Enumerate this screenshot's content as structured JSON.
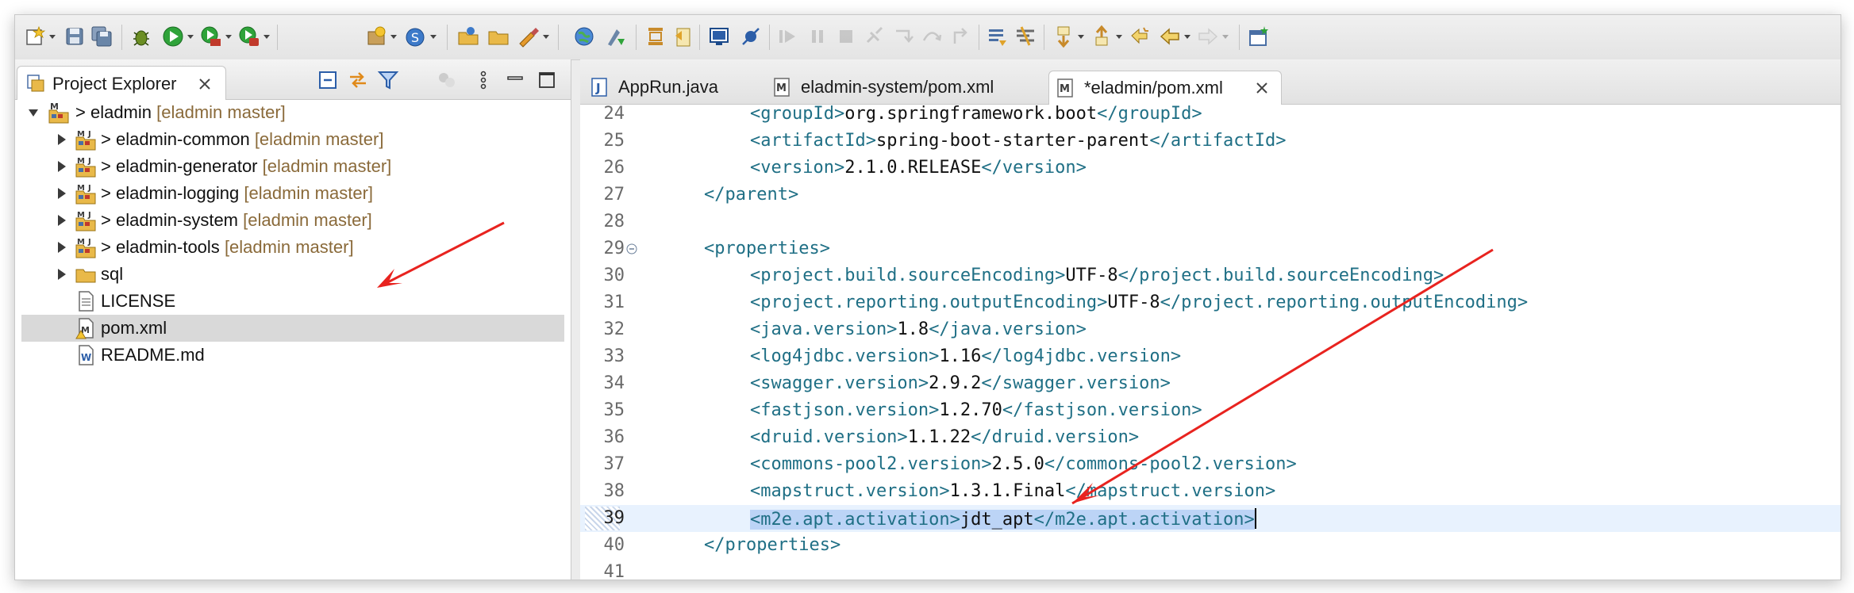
{
  "explorer": {
    "tab_label": "Project Explorer",
    "tree": [
      {
        "name": "> eladmin",
        "decoration": "[eladmin master]",
        "expanded": true,
        "level": 0
      },
      {
        "name": "> eladmin-common",
        "decoration": "[eladmin master]",
        "level": 1
      },
      {
        "name": "> eladmin-generator",
        "decoration": "[eladmin master]",
        "level": 1
      },
      {
        "name": "> eladmin-logging",
        "decoration": "[eladmin master]",
        "level": 1
      },
      {
        "name": "> eladmin-system",
        "decoration": "[eladmin master]",
        "level": 1
      },
      {
        "name": "> eladmin-tools",
        "decoration": "[eladmin master]",
        "level": 1
      },
      {
        "name": "sql",
        "decoration": "",
        "level": 1
      },
      {
        "name": "LICENSE",
        "decoration": "",
        "level": 1
      },
      {
        "name": "pom.xml",
        "decoration": "",
        "level": 1,
        "selected": true
      },
      {
        "name": "README.md",
        "decoration": "",
        "level": 1
      }
    ]
  },
  "editor": {
    "tabs": [
      {
        "label": "AppRun.java",
        "active": false
      },
      {
        "label": "eladmin-system/pom.xml",
        "active": false
      },
      {
        "label": "*eladmin/pom.xml",
        "active": true
      }
    ],
    "lines": [
      {
        "num": "24",
        "indent": 2,
        "tag1": "<groupId>",
        "value": "org.springframework.boot",
        "tag2": "</groupId>"
      },
      {
        "num": "25",
        "indent": 2,
        "tag1": "<artifactId>",
        "value": "spring-boot-starter-parent",
        "tag2": "</artifactId>"
      },
      {
        "num": "26",
        "indent": 2,
        "tag1": "<version>",
        "value": "2.1.0.RELEASE",
        "tag2": "</version>"
      },
      {
        "num": "27",
        "indent": 1,
        "tag1": "</parent>",
        "value": "",
        "tag2": ""
      },
      {
        "num": "28",
        "indent": 0,
        "tag1": "",
        "value": "",
        "tag2": ""
      },
      {
        "num": "29",
        "indent": 1,
        "tag1": "<properties>",
        "value": "",
        "tag2": "",
        "fold": true
      },
      {
        "num": "30",
        "indent": 2,
        "tag1": "<project.build.sourceEncoding>",
        "value": "UTF-8",
        "tag2": "</project.build.sourceEncoding>"
      },
      {
        "num": "31",
        "indent": 2,
        "tag1": "<project.reporting.outputEncoding>",
        "value": "UTF-8",
        "tag2": "</project.reporting.outputEncoding>"
      },
      {
        "num": "32",
        "indent": 2,
        "tag1": "<java.version>",
        "value": "1.8",
        "tag2": "</java.version>"
      },
      {
        "num": "33",
        "indent": 2,
        "tag1": "<log4jdbc.version>",
        "value": "1.16",
        "tag2": "</log4jdbc.version>"
      },
      {
        "num": "34",
        "indent": 2,
        "tag1": "<swagger.version>",
        "value": "2.9.2",
        "tag2": "</swagger.version>"
      },
      {
        "num": "35",
        "indent": 2,
        "tag1": "<fastjson.version>",
        "value": "1.2.70",
        "tag2": "</fastjson.version>"
      },
      {
        "num": "36",
        "indent": 2,
        "tag1": "<druid.version>",
        "value": "1.1.22",
        "tag2": "</druid.version>"
      },
      {
        "num": "37",
        "indent": 2,
        "tag1": "<commons-pool2.version>",
        "value": "2.5.0",
        "tag2": "</commons-pool2.version>"
      },
      {
        "num": "38",
        "indent": 2,
        "tag1": "<mapstruct.version>",
        "value": "1.3.1.Final",
        "tag2": "</mapstruct.version>"
      },
      {
        "num": "39",
        "indent": 2,
        "tag1": "<m2e.apt.activation>",
        "value": "jdt_apt",
        "tag2": "</m2e.apt.activation>",
        "current": true,
        "selected": true
      },
      {
        "num": "40",
        "indent": 1,
        "tag1": "</properties>",
        "value": "",
        "tag2": ""
      },
      {
        "num": "41",
        "indent": 0,
        "tag1": "",
        "value": "",
        "tag2": ""
      }
    ]
  },
  "colors": {
    "tag": "#1f6f85",
    "annotation_arrow": "#e8231f",
    "current_line": "#e8f2fe",
    "selection": "#bcd4f6"
  },
  "icons": {
    "toolbar": [
      "new-icon",
      "save-icon",
      "save-all-icon",
      "debug-icon",
      "run-icon",
      "coverage-icon",
      "external-tools-icon",
      "new-java-project-icon",
      "new-class-icon",
      "open-type-icon",
      "open-folder-icon",
      "search-icon",
      "globe-icon",
      "refactor-icon",
      "task-icon",
      "clipboard-icon",
      "console-icon",
      "skip-breakpoints-icon",
      "resume-icon",
      "suspend-icon",
      "terminate-icon",
      "disconnect-icon",
      "step-into-icon",
      "step-over-icon",
      "step-return-icon",
      "annotation-icon",
      "toggle-mark-icon",
      "next-annotation-icon",
      "prev-annotation-icon",
      "last-edit-icon",
      "back-icon",
      "forward-icon",
      "open-perspective-icon"
    ]
  }
}
